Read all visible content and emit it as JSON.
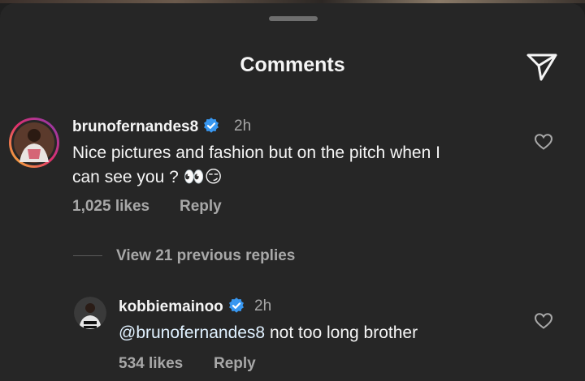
{
  "header": {
    "title": "Comments"
  },
  "comments": [
    {
      "username": "brunofernandes8",
      "time": "2h",
      "text": "Nice pictures and fashion but on the pitch when I",
      "text2": "can see you ?",
      "emojis": "👀😏",
      "likes": "1,025 likes",
      "reply_label": "Reply"
    }
  ],
  "view_replies": "View 21 previous replies",
  "replies": [
    {
      "username": "kobbiemainoo",
      "time": "2h",
      "mention": "@brunofernandes8",
      "text": " not too long brother",
      "likes": "534 likes",
      "reply_label": "Reply"
    }
  ],
  "colors": {
    "background": "#262626",
    "text": "#f5f5f5",
    "muted": "#a8a8a8",
    "verified": "#3897f0"
  },
  "icons": [
    "share-icon",
    "verified-icon",
    "heart-icon"
  ]
}
